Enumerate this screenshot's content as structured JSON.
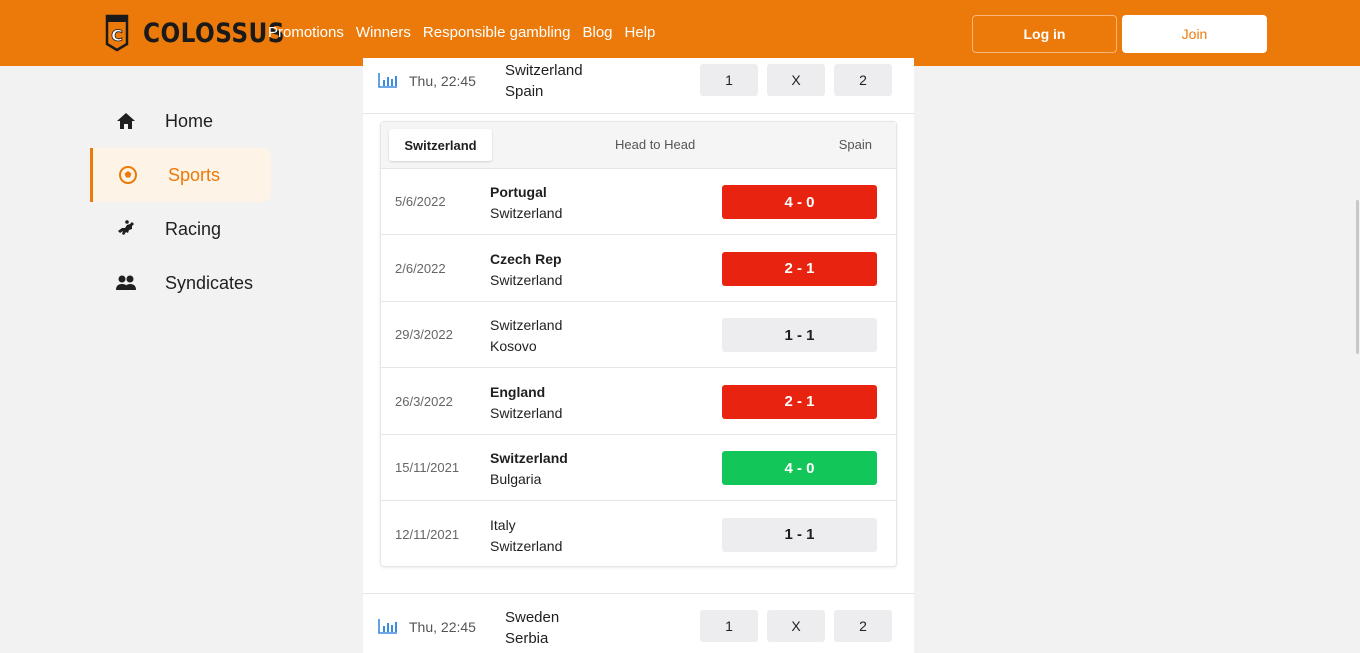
{
  "brand": {
    "name": "COLOSSUS",
    "logo_letter": "C",
    "accent": "#ec7a0a"
  },
  "nav": [
    "Promotions",
    "Winners",
    "Responsible gambling",
    "Blog",
    "Help"
  ],
  "auth": {
    "login": "Log in",
    "join": "Join"
  },
  "sidebar": {
    "items": [
      {
        "label": "Home",
        "icon": "home-icon"
      },
      {
        "label": "Sports",
        "icon": "soccer-ball-icon",
        "active": true
      },
      {
        "label": "Racing",
        "icon": "horse-racing-icon"
      },
      {
        "label": "Syndicates",
        "icon": "users-icon"
      }
    ]
  },
  "matches": [
    {
      "time": "Thu, 22:45",
      "home": "Switzerland",
      "away": "Spain",
      "odds": [
        "1",
        "X",
        "2"
      ]
    },
    {
      "time": "Thu, 22:45",
      "home": "Sweden",
      "away": "Serbia",
      "odds": [
        "1",
        "X",
        "2"
      ]
    }
  ],
  "h2h": {
    "tabs": {
      "home": "Switzerland",
      "middle": "Head to Head",
      "away": "Spain"
    },
    "rows": [
      {
        "date": "5/6/2022",
        "team1": "Portugal",
        "team2": "Switzerland",
        "score": "4 - 0",
        "result": "loss",
        "bold": 1
      },
      {
        "date": "2/6/2022",
        "team1": "Czech Rep",
        "team2": "Switzerland",
        "score": "2 - 1",
        "result": "loss",
        "bold": 1
      },
      {
        "date": "29/3/2022",
        "team1": "Switzerland",
        "team2": "Kosovo",
        "score": "1 - 1",
        "result": "draw",
        "bold": 0
      },
      {
        "date": "26/3/2022",
        "team1": "England",
        "team2": "Switzerland",
        "score": "2 - 1",
        "result": "loss",
        "bold": 1
      },
      {
        "date": "15/11/2021",
        "team1": "Switzerland",
        "team2": "Bulgaria",
        "score": "4 - 0",
        "result": "win",
        "bold": 1
      },
      {
        "date": "12/11/2021",
        "team1": "Italy",
        "team2": "Switzerland",
        "score": "1 - 1",
        "result": "draw",
        "bold": 0
      }
    ]
  },
  "colors": {
    "loss": "#e8230f",
    "win": "#12c65a",
    "draw": "#ededef"
  }
}
